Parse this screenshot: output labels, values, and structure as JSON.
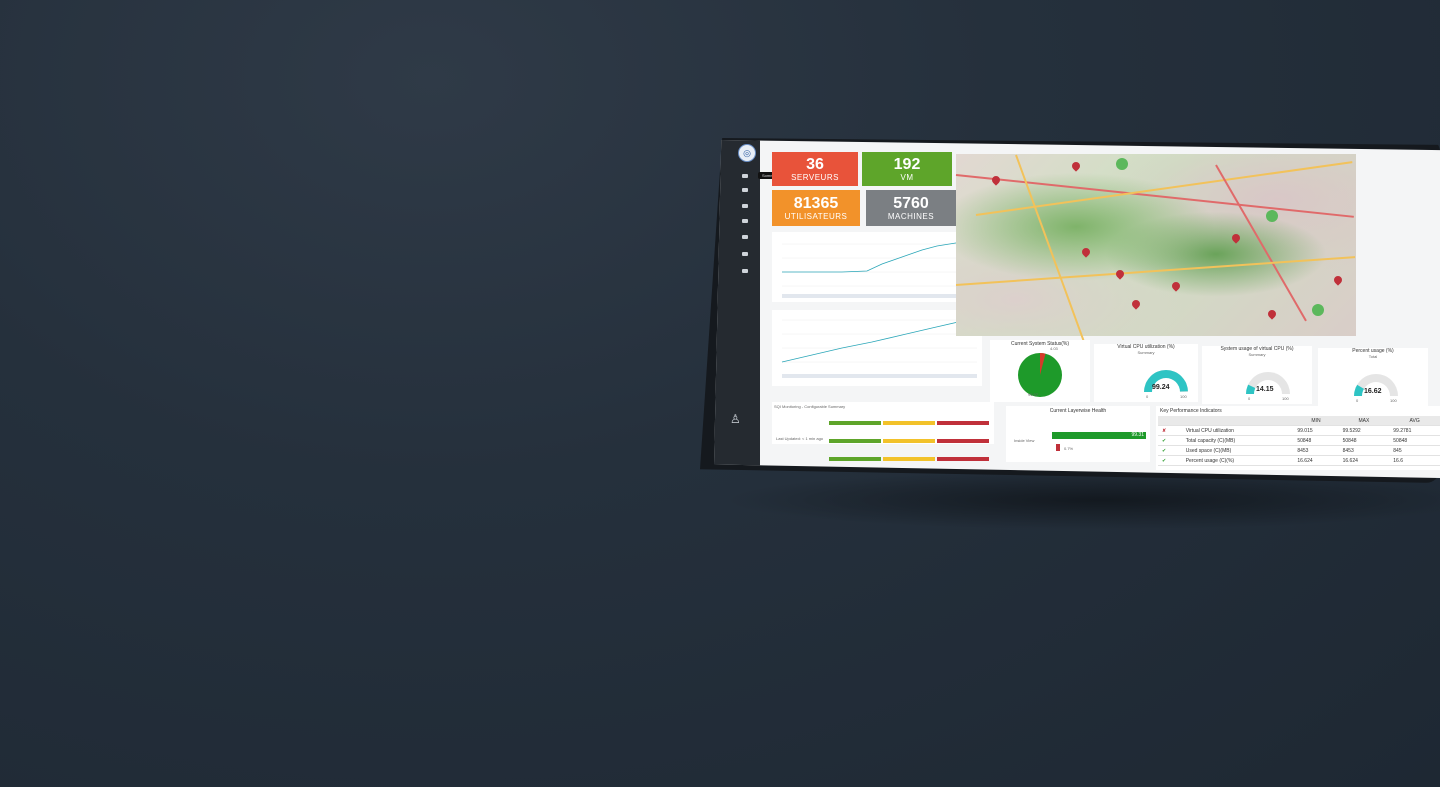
{
  "sidebar": {
    "tooltip": "Sommaire",
    "items": [
      "dashboard-icon",
      "eye-icon",
      "link-icon",
      "cloud-icon",
      "bell-icon",
      "card-icon",
      "key-icon"
    ]
  },
  "tiles": [
    {
      "value": "36",
      "label": "SERVEURS",
      "color": "#e8533a"
    },
    {
      "value": "192",
      "label": "VM",
      "color": "#5ea52a"
    },
    {
      "value": "81365",
      "label": "UTILISATEURS",
      "color": "#f2922a"
    },
    {
      "value": "5760",
      "label": "MACHINES",
      "color": "#7b7f83"
    }
  ],
  "pie": {
    "title": "Current System Status(%)",
    "big": "95.97",
    "small": "4.03"
  },
  "gauges": [
    {
      "title": "Virtual CPU utilization (%)",
      "subtitle": "Summary",
      "value": "99.24",
      "min": "0",
      "max": "100",
      "fraction": 0.99
    },
    {
      "title": "System usage of virtual CPU (%)",
      "subtitle": "Summary",
      "value": "14.15",
      "min": "0",
      "max": "100",
      "fraction": 0.14
    },
    {
      "title": "Percent usage (%)",
      "subtitle": "Total",
      "value": "16.62",
      "min": "0",
      "max": "100",
      "fraction": 0.17
    }
  ],
  "health": {
    "title": "Current Layerwise Health",
    "row_label": "Inside View",
    "green": "99.31",
    "red": "0.7%"
  },
  "kpi": {
    "title": "Key Performance Indicators",
    "headers": [
      "",
      "",
      "MIN",
      "MAX",
      "AVG"
    ],
    "rows": [
      {
        "status": "cross",
        "name": "Virtual CPU utilization",
        "min": "99.015",
        "max": "99.5292",
        "avg": "99.2781"
      },
      {
        "status": "check",
        "name": "Total capacity (C)(MB)",
        "min": "50848",
        "max": "50848",
        "avg": "50848"
      },
      {
        "status": "check",
        "name": "Used space (C)(MB)",
        "min": "8453",
        "max": "8453",
        "avg": "845"
      },
      {
        "status": "check",
        "name": "Percent usage (C)(%)",
        "min": "16.624",
        "max": "16.624",
        "avg": "16.6"
      }
    ]
  },
  "summary_table": {
    "title": "SQI Monitoring - Configurable Summary",
    "footer": "Last Updated: < 1 min ago"
  }
}
